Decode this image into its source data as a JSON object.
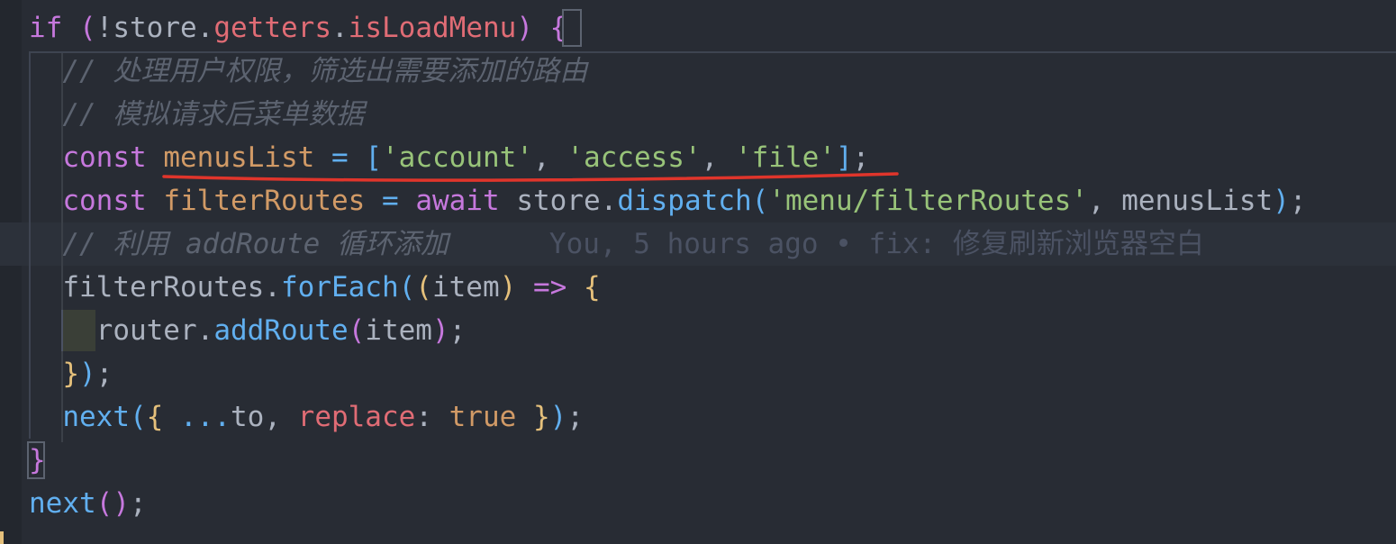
{
  "editor": {
    "lines": [
      {
        "id": "line-1",
        "tokens": [
          {
            "t": "if",
            "c": "kw"
          },
          {
            "t": " ",
            "c": "plain"
          },
          {
            "t": "(",
            "c": "b2"
          },
          {
            "t": "!",
            "c": "plain"
          },
          {
            "t": "store",
            "c": "plain"
          },
          {
            "t": ".",
            "c": "plain"
          },
          {
            "t": "getters",
            "c": "prop"
          },
          {
            "t": ".",
            "c": "plain"
          },
          {
            "t": "isLoadMenu",
            "c": "prop"
          },
          {
            "t": ")",
            "c": "b2"
          },
          {
            "t": " ",
            "c": "plain"
          },
          {
            "t": "{",
            "c": "b2"
          }
        ]
      },
      {
        "id": "line-2",
        "tokens": [
          {
            "t": "  // 处理用户权限，筛选出需要添加的路由",
            "c": "cmt"
          }
        ]
      },
      {
        "id": "line-3",
        "tokens": [
          {
            "t": "  // 模拟请求后菜单数据",
            "c": "cmt"
          }
        ]
      },
      {
        "id": "line-4",
        "tokens": [
          {
            "t": "  ",
            "c": "plain"
          },
          {
            "t": "const",
            "c": "kw"
          },
          {
            "t": " ",
            "c": "plain"
          },
          {
            "t": "menusList",
            "c": "var"
          },
          {
            "t": " ",
            "c": "plain"
          },
          {
            "t": "=",
            "c": "fn"
          },
          {
            "t": " ",
            "c": "plain"
          },
          {
            "t": "[",
            "c": "b3"
          },
          {
            "t": "'account'",
            "c": "str"
          },
          {
            "t": ", ",
            "c": "plain"
          },
          {
            "t": "'access'",
            "c": "str"
          },
          {
            "t": ", ",
            "c": "plain"
          },
          {
            "t": "'file'",
            "c": "str"
          },
          {
            "t": "]",
            "c": "b3"
          },
          {
            "t": ";",
            "c": "plain"
          }
        ]
      },
      {
        "id": "line-5",
        "tokens": [
          {
            "t": "  ",
            "c": "plain"
          },
          {
            "t": "const",
            "c": "kw"
          },
          {
            "t": " ",
            "c": "plain"
          },
          {
            "t": "filterRoutes",
            "c": "var"
          },
          {
            "t": " ",
            "c": "plain"
          },
          {
            "t": "=",
            "c": "fn"
          },
          {
            "t": " ",
            "c": "plain"
          },
          {
            "t": "await",
            "c": "kw"
          },
          {
            "t": " ",
            "c": "plain"
          },
          {
            "t": "store",
            "c": "plain"
          },
          {
            "t": ".",
            "c": "plain"
          },
          {
            "t": "dispatch",
            "c": "fn"
          },
          {
            "t": "(",
            "c": "b3"
          },
          {
            "t": "'menu/filterRoutes'",
            "c": "str"
          },
          {
            "t": ", ",
            "c": "plain"
          },
          {
            "t": "menusList",
            "c": "plain"
          },
          {
            "t": ")",
            "c": "b3"
          },
          {
            "t": ";",
            "c": "plain"
          }
        ]
      },
      {
        "id": "line-6",
        "current": true,
        "tokens": [
          {
            "t": "  // 利用 addRoute 循环添加",
            "c": "cmt"
          },
          {
            "t": "      You, 5 hours ago • fix: 修复刷新浏览器空白",
            "c": "blame"
          }
        ]
      },
      {
        "id": "line-7",
        "tokens": [
          {
            "t": "  ",
            "c": "plain"
          },
          {
            "t": "filterRoutes",
            "c": "plain"
          },
          {
            "t": ".",
            "c": "plain"
          },
          {
            "t": "forEach",
            "c": "fn"
          },
          {
            "t": "(",
            "c": "b3"
          },
          {
            "t": "(",
            "c": "b1"
          },
          {
            "t": "item",
            "c": "plain"
          },
          {
            "t": ")",
            "c": "b1"
          },
          {
            "t": " ",
            "c": "plain"
          },
          {
            "t": "=>",
            "c": "kw"
          },
          {
            "t": " ",
            "c": "plain"
          },
          {
            "t": "{",
            "c": "b1"
          }
        ]
      },
      {
        "id": "line-8",
        "tokens": [
          {
            "t": "    ",
            "c": "plain"
          },
          {
            "t": "router",
            "c": "plain"
          },
          {
            "t": ".",
            "c": "plain"
          },
          {
            "t": "addRoute",
            "c": "fn"
          },
          {
            "t": "(",
            "c": "b2"
          },
          {
            "t": "item",
            "c": "plain"
          },
          {
            "t": ")",
            "c": "b2"
          },
          {
            "t": ";",
            "c": "plain"
          }
        ]
      },
      {
        "id": "line-9",
        "tokens": [
          {
            "t": "  ",
            "c": "plain"
          },
          {
            "t": "}",
            "c": "b1"
          },
          {
            "t": ")",
            "c": "b3"
          },
          {
            "t": ";",
            "c": "plain"
          }
        ]
      },
      {
        "id": "line-10",
        "tokens": [
          {
            "t": "  ",
            "c": "plain"
          },
          {
            "t": "next",
            "c": "fn"
          },
          {
            "t": "(",
            "c": "b3"
          },
          {
            "t": "{",
            "c": "b1"
          },
          {
            "t": " ",
            "c": "plain"
          },
          {
            "t": "...",
            "c": "fn"
          },
          {
            "t": "to",
            "c": "plain"
          },
          {
            "t": ", ",
            "c": "plain"
          },
          {
            "t": "replace",
            "c": "prop"
          },
          {
            "t": ": ",
            "c": "plain"
          },
          {
            "t": "true",
            "c": "bool"
          },
          {
            "t": " ",
            "c": "plain"
          },
          {
            "t": "}",
            "c": "b1"
          },
          {
            "t": ")",
            "c": "b3"
          },
          {
            "t": ";",
            "c": "plain"
          }
        ]
      },
      {
        "id": "line-11",
        "tokens": [
          {
            "t": "}",
            "c": "b2"
          }
        ]
      },
      {
        "id": "line-12",
        "tokens": [
          {
            "t": "next",
            "c": "fn"
          },
          {
            "t": "(",
            "c": "b2"
          },
          {
            "t": ")",
            "c": "b2"
          },
          {
            "t": ";",
            "c": "plain"
          }
        ]
      }
    ],
    "annotation": {
      "underline_color": "#e0352b"
    }
  }
}
